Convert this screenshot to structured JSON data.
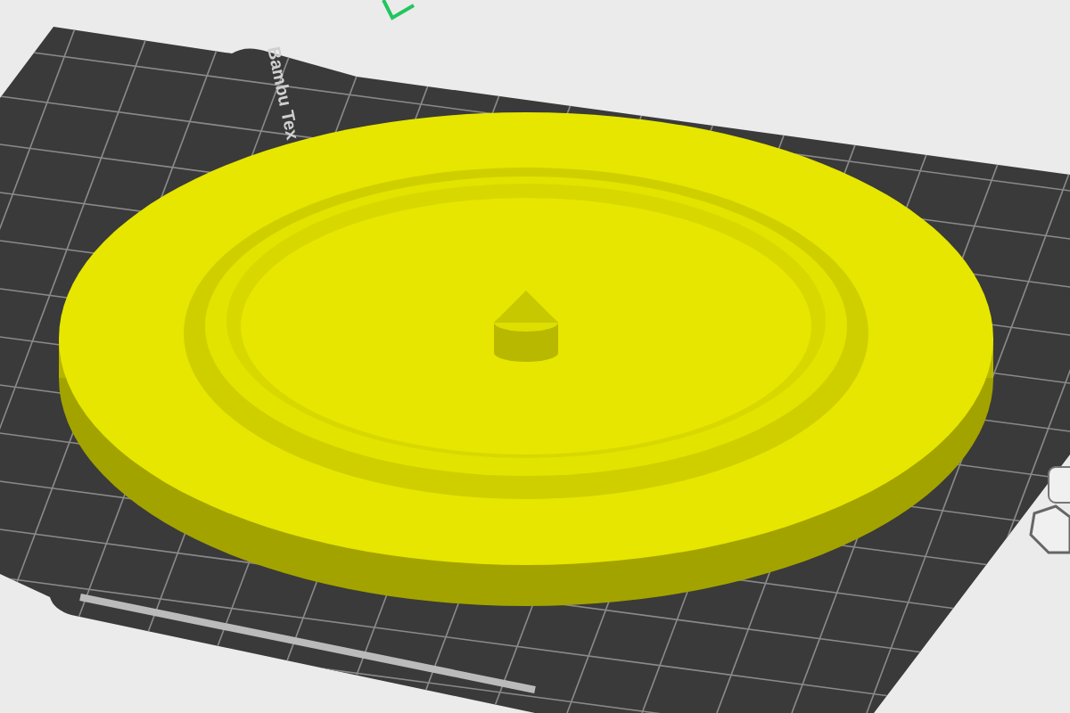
{
  "plate": {
    "label": "Bambu Tex"
  }
}
